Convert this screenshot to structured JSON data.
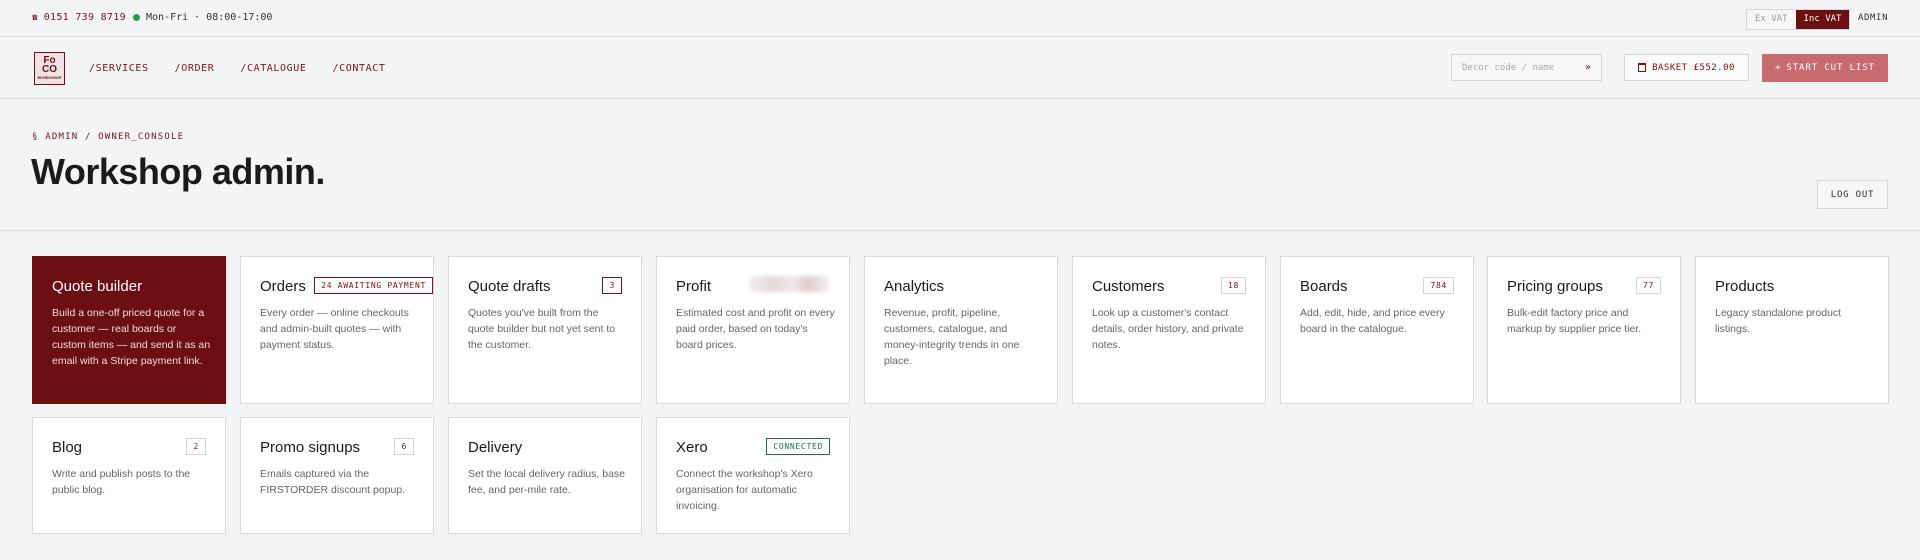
{
  "topbar": {
    "phone": "0151 739 8719",
    "hours": "Mon-Fri · 08:00-17:00",
    "vat_ex": "Ex VAT",
    "vat_inc": "Inc VAT",
    "vat_selected": "Inc VAT",
    "admin": "ADMIN"
  },
  "nav": {
    "logo_line1": "Fo",
    "logo_line2": "CO",
    "logo_line3": "WORKSHOP",
    "links": [
      "/SERVICES",
      "/ORDER",
      "/CATALOGUE",
      "/CONTACT"
    ],
    "search_placeholder": "Decor code / name",
    "search_go": "»",
    "basket": "BASKET £552.00",
    "start_cut_list": "START CUT LIST",
    "start_prefix": "+"
  },
  "header": {
    "breadcrumb": "§ ADMIN / OWNER_CONSOLE",
    "title": "Workshop admin.",
    "logout": "LOG OUT"
  },
  "cards": [
    {
      "title": "Quote builder",
      "desc": "Build a one-off priced quote for a customer — real boards or custom items — and send it as an email with a Stripe payment link.",
      "badge": ""
    },
    {
      "title": "Orders",
      "desc": "Every order — online checkouts and admin-built quotes — with payment status.",
      "badge": "24 AWAITING PAYMENT"
    },
    {
      "title": "Quote drafts",
      "desc": "Quotes you've built from the quote builder but not yet sent to the customer.",
      "badge": "3"
    },
    {
      "title": "Profit",
      "desc": "Estimated cost and profit on every paid order, based on today's board prices.",
      "badge": ""
    },
    {
      "title": "Analytics",
      "desc": "Revenue, profit, pipeline, customers, catalogue, and money-integrity trends in one place.",
      "badge": ""
    },
    {
      "title": "Customers",
      "desc": "Look up a customer's contact details, order history, and private notes.",
      "badge": "18"
    },
    {
      "title": "Boards",
      "desc": "Add, edit, hide, and price every board in the catalogue.",
      "badge": "784"
    },
    {
      "title": "Pricing groups",
      "desc": "Bulk-edit factory price and markup by supplier price tier.",
      "badge": "77"
    },
    {
      "title": "Products",
      "desc": "Legacy standalone product listings.",
      "badge": ""
    },
    {
      "title": "Blog",
      "desc": "Write and publish posts to the public blog.",
      "badge": "2"
    },
    {
      "title": "Promo signups",
      "desc": "Emails captured via the FIRSTORDER discount popup.",
      "badge": "6"
    },
    {
      "title": "Delivery",
      "desc": "Set the local delivery radius, base fee, and per-mile rate.",
      "badge": ""
    },
    {
      "title": "Xero",
      "desc": "Connect the workshop's Xero organisation for automatic invoicing.",
      "badge": "CONNECTED"
    }
  ]
}
